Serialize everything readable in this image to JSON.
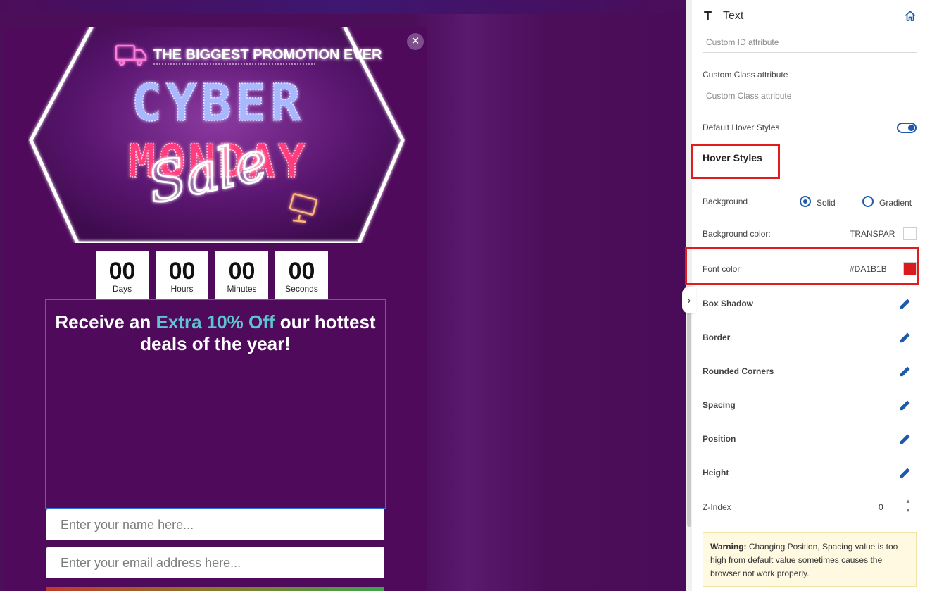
{
  "popup": {
    "close_glyph": "✕",
    "banner": {
      "tagline": "THE BIGGEST PROMOTION EVER",
      "line1": "CYBER",
      "line2": "MONDAY",
      "script": "Sale"
    },
    "countdown": [
      {
        "value": "00",
        "label": "Days"
      },
      {
        "value": "00",
        "label": "Hours"
      },
      {
        "value": "00",
        "label": "Minutes"
      },
      {
        "value": "00",
        "label": "Seconds"
      }
    ],
    "headline": {
      "prefix": "Receive an ",
      "accent": "Extra 10% Off",
      "suffix": " our hottest deals of the year!"
    },
    "name_placeholder": "Enter your name here...",
    "email_placeholder": "Enter your email address here..."
  },
  "panel": {
    "title": "Text",
    "icons": {
      "title": "text-t-icon",
      "home": "home-icon",
      "edit": "pencil-icon"
    },
    "custom_id_placeholder": "Custom ID attribute",
    "custom_class_label": "Custom Class attribute",
    "custom_class_placeholder": "Custom Class attribute",
    "default_hover_label": "Default Hover Styles",
    "default_hover_on": true,
    "hover_styles_title": "Hover Styles",
    "background_label": "Background",
    "radio_solid": "Solid",
    "radio_gradient": "Gradient",
    "background_color_label": "Background color:",
    "background_color_value": "TRANSPAR",
    "font_color_label": "Font color",
    "font_color_value": "#DA1B1B",
    "font_color_swatch": "#DA1B1B",
    "sections": [
      "Box Shadow",
      "Border",
      "Rounded Corners",
      "Spacing",
      "Position",
      "Height"
    ],
    "zindex_label": "Z-Index",
    "zindex_value": "0",
    "warning_title": "Warning:",
    "warning_text": " Changing Position, Spacing value is too high from default value sometimes causes the browser not work properly."
  },
  "colors": {
    "accent": "#5fc4cf",
    "popup_bg": "#4f0a5c",
    "highlight": "#e41b1b",
    "primary": "#1e5aa8"
  }
}
